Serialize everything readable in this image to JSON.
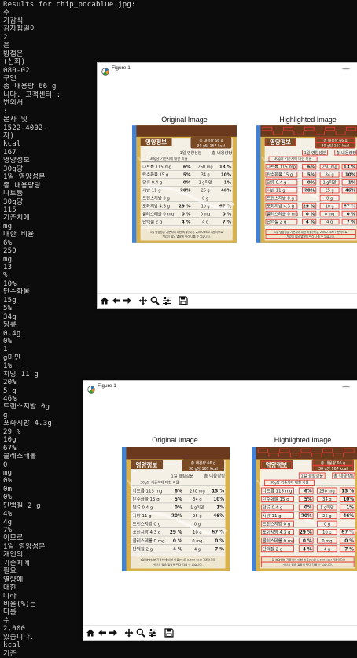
{
  "terminal": {
    "lines": [
      "Results for chip_pocablue.jpg:",
      "추",
      "가감식",
      "감자칩일이",
      "2",
      "은",
      "방접은",
      "(신화)",
      "080-02",
      "구언",
      "총 내용량 66 g",
      "니다. 고객센터 :",
      "번외서",
      ":",
      "본사 및",
      "1522-4002-",
      "자)",
      "kcal",
      "167",
      "영양정보",
      "30g당",
      "1일 영양성분",
      "총 내용량당",
      "나트륨",
      "30g당",
      "115",
      "기준치에",
      "mg",
      "대한 비율",
      "6%",
      "250",
      "mg",
      "13",
      "%",
      "10%",
      "탄수화물",
      "15g",
      "5%",
      "34g",
      "당류",
      "0.4g",
      "0%",
      "1",
      "g미만",
      "1%",
      "지방 11 g",
      "20%",
      "5 g",
      "46%",
      "트랜스지방 0g",
      "g",
      "포화지방 4.3g",
      "29 %",
      "10g",
      "67%",
      "콜레스테롤",
      "0",
      "mg",
      "0%",
      "0m",
      "0%",
      "단백질 2 g",
      "4%",
      "4g",
      "7%",
      "이므로",
      "1일 영양성분",
      "개인의",
      "기준치에",
      "필요",
      "열량에",
      "대한",
      "따라",
      "비율(%)은",
      "다를",
      "수",
      "2,000",
      "있습니다.",
      "kcal",
      "기준"
    ]
  },
  "figure1": {
    "window_title": "Figure 1",
    "left_title": "Original Image",
    "right_title": "Highlighted Image",
    "minimize_symbol": "—"
  },
  "figure2": {
    "window_title": "Figure 1",
    "left_title": "Original Image",
    "right_title": "Highlighted Image",
    "minimize_symbol": "—"
  },
  "label": {
    "header_left": "영양정보",
    "header_right_1": "총 내용량 66 g",
    "header_right_2": "30 g당 167 kcal",
    "col_a": "1일 영양성분",
    "col_b": "총 내용량당",
    "col_c": "30g당 기준치에 대한 비율",
    "rows": [
      {
        "name": "나트륨 115 mg",
        "pct": "6%",
        "mid": "250 mg",
        "pct2": "13 %"
      },
      {
        "name": "탄수화물 15 g",
        "pct": "5%",
        "mid": "34 g",
        "pct2": "10%"
      },
      {
        "name": "당류 0.4 g",
        "pct": "0%",
        "mid": "1 g미만",
        "pct2": "1%"
      },
      {
        "name": "지방 11 g",
        "pct": "20%",
        "mid": "25 g",
        "pct2": "46%"
      },
      {
        "name": "트랜스지방 0 g",
        "pct": "",
        "mid": "0 g",
        "pct2": ""
      },
      {
        "name": "포화지방 4.3 g",
        "pct": "29 %",
        "mid": "10 g",
        "pct2": "67 %"
      },
      {
        "name": "콜레스테롤 0 mg",
        "pct": "0 %",
        "mid": "0 mg",
        "pct2": "0 %"
      },
      {
        "name": "단백질 2 g",
        "pct": "4 %",
        "mid": "4 g",
        "pct2": "7 %"
      }
    ],
    "footer": "1일 영양성분 기준치에 대한 비율(%)은 2,000 kcal 기준이므로 개인의 필요 열량에 따라 다를 수 있습니다."
  },
  "colors": {
    "terminal_bg": "#0c0c0c",
    "terminal_fg": "#d8d8d8",
    "label_gold": "#d9b14a",
    "label_brown": "#7a4a25",
    "highlight_red": "#e53935",
    "pack_blue": "#3f82d6"
  },
  "toolbar_icons": [
    "home-icon",
    "back-icon",
    "forward-icon",
    "pan-icon",
    "zoom-icon",
    "configure-icon",
    "save-icon"
  ]
}
